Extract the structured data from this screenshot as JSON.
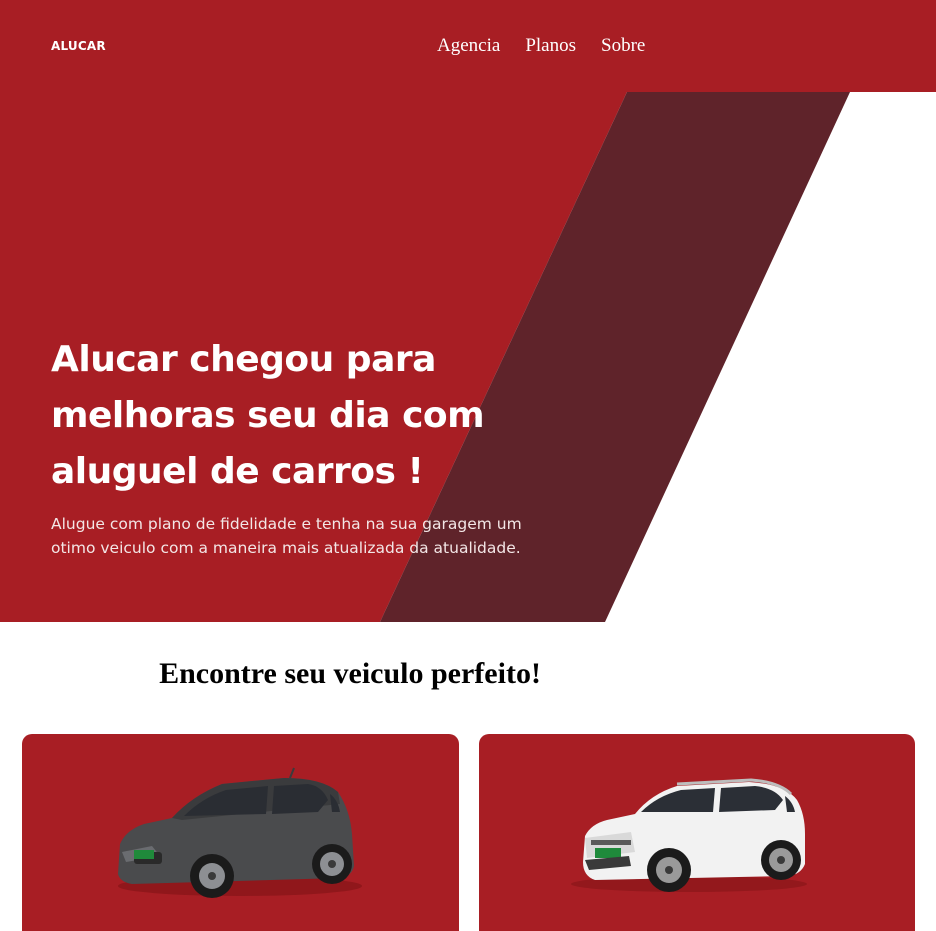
{
  "header": {
    "logo": "ALUCAR",
    "nav": [
      "Agencia",
      "Planos",
      "Sobre"
    ]
  },
  "hero": {
    "title_lines": [
      "Alucar chegou para",
      "melhoras seu dia com",
      "aluguel de carros !"
    ],
    "subtitle_lines": [
      "Alugue com plano de fidelidade e tenha na sua garagem um",
      "otimo veiculo com a maneira mais atualizada da atualidade."
    ]
  },
  "section": {
    "title": "Encontre seu veiculo perfeito!"
  },
  "cars": [
    {
      "image": "dark-gray-hatchback-car",
      "color": "#4a4b4d"
    },
    {
      "image": "white-suv-car",
      "color": "#f2f2f2"
    }
  ],
  "colors": {
    "brand_red": "#a81e24",
    "dark_stripe": "#5f232a",
    "white": "#ffffff"
  }
}
